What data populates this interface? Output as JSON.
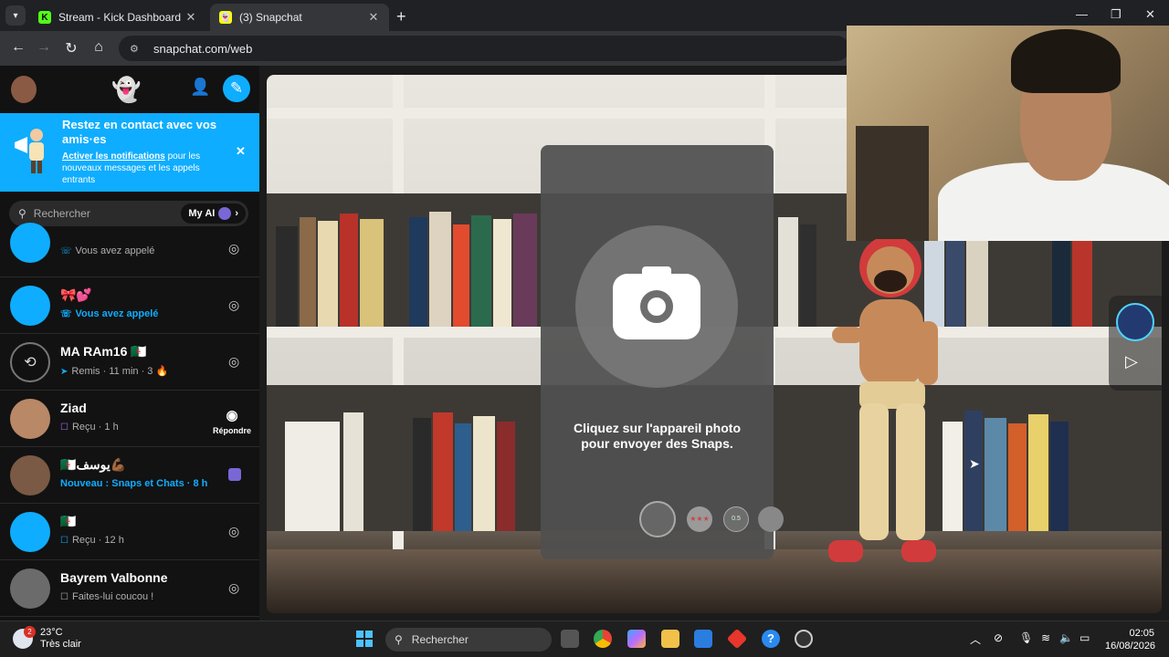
{
  "browser": {
    "tabs": [
      {
        "title": "Stream - Kick Dashboard",
        "favicon": "K",
        "active": false
      },
      {
        "title": "(3) Snapchat",
        "favicon": "snap-ghost",
        "active": true
      }
    ],
    "url": "snapchat.com/web",
    "window_controls": [
      "minimize",
      "maximize",
      "close"
    ]
  },
  "snapchat": {
    "notification": {
      "title": "Restez en contact avec vos amis·es",
      "link": "Activer les notifications",
      "body": " pour les nouveaux messages et les appels entrants"
    },
    "search": {
      "placeholder": "Rechercher",
      "myai_label": "My AI"
    },
    "chats": [
      {
        "name": "",
        "status": "Vous avez appelé",
        "status_style": "gray",
        "avatar": "blue-silhouette",
        "action": "camera"
      },
      {
        "name": "🎀💕",
        "status": "Vous avez appelé",
        "status_style": "blue",
        "avatar": "blue-silhouette",
        "action": "camera"
      },
      {
        "name": "MA RAm16 🇩🇿",
        "status": "Remis · 11 min · 3 🔥",
        "status_style": "gray",
        "avatar": "ring",
        "action": "camera"
      },
      {
        "name": "Ziad",
        "status": "Reçu · 1 h",
        "status_style": "gray",
        "avatar": "bitmoji",
        "action": "reply",
        "action_label": "Répondre"
      },
      {
        "name": "🇩🇿يوسف💪🏾",
        "status": "Nouveau : Snaps et Chats · 8 h",
        "status_style": "blue",
        "avatar": "bitmoji",
        "action": "chat-icon"
      },
      {
        "name": "🇩🇿",
        "status": "Reçu · 12 h",
        "status_style": "gray",
        "avatar": "blue-silhouette",
        "action": "camera"
      },
      {
        "name": "Bayrem Valbonne",
        "status": "Faites-lui coucou !",
        "status_style": "gray",
        "avatar": "gray-silhouette",
        "action": "camera"
      }
    ],
    "camera": {
      "hint": "Cliquez sur l'appareil photo pour envoyer des Snaps.",
      "lens_labels": [
        "",
        "★★★",
        "0.5",
        ""
      ]
    }
  },
  "taskbar": {
    "weather": {
      "temp": "23°C",
      "desc": "Très clair",
      "badge": "2"
    },
    "search_placeholder": "Rechercher",
    "time": "02:05",
    "date": "16/08/2026"
  },
  "colors": {
    "snap_blue": "#0fadff",
    "snap_yellow": "#fffc00",
    "kick_green": "#53fc18"
  }
}
